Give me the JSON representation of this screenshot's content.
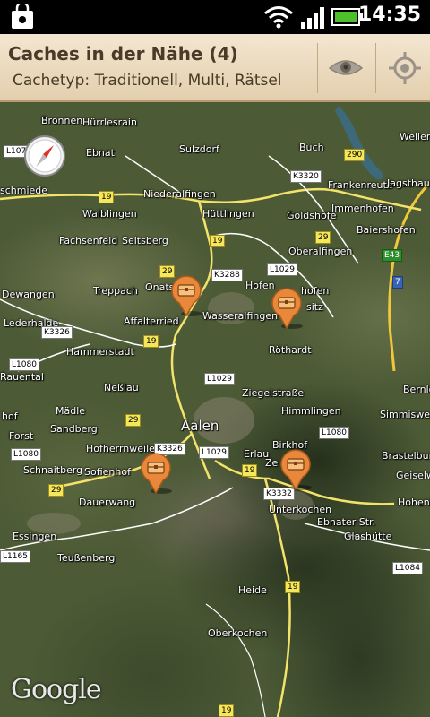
{
  "status_bar": {
    "time": "14:35",
    "icons": [
      "market-bag-icon",
      "wifi-icon",
      "signal-icon",
      "battery-icon"
    ]
  },
  "header": {
    "title": "Caches in der Nähe (4)",
    "subtitle": "Cachetyp: Traditionell, Multi, Rätsel",
    "buttons": [
      {
        "name": "visibility",
        "icon": "eye-icon"
      },
      {
        "name": "my-location",
        "icon": "crosshair-icon"
      }
    ]
  },
  "map": {
    "places": [
      {
        "id": "bronnen",
        "label": "Bronnen"
      },
      {
        "id": "hurrlesrain",
        "label": "Hürrlesrain"
      },
      {
        "id": "ebnat",
        "label": "Ebnat"
      },
      {
        "id": "sulzdorf",
        "label": "Sulzdorf"
      },
      {
        "id": "buch",
        "label": "Buch"
      },
      {
        "id": "weiler",
        "label": "Weiler"
      },
      {
        "id": "schmiede",
        "label": "schmiede"
      },
      {
        "id": "niederalfingen",
        "label": "Niederalfingen"
      },
      {
        "id": "frankenreute",
        "label": "Frankenreute"
      },
      {
        "id": "jagsthausen",
        "label": "Jagsthause"
      },
      {
        "id": "waiblingen",
        "label": "Waiblingen"
      },
      {
        "id": "huttlingen",
        "label": "Hüttlingen"
      },
      {
        "id": "goldshofe",
        "label": "Goldshöfe"
      },
      {
        "id": "immenhofen",
        "label": "Immenhofen"
      },
      {
        "id": "baiershofen",
        "label": "Baiershofen"
      },
      {
        "id": "fachsenfeld",
        "label": "Fachsenfeld"
      },
      {
        "id": "seitsberg",
        "label": "Seitsberg"
      },
      {
        "id": "oberalfingen",
        "label": "Oberalfingen"
      },
      {
        "id": "onatsfeld",
        "label": "Onatsf"
      },
      {
        "id": "hofen",
        "label": "Hofen"
      },
      {
        "id": "dewangen",
        "label": "Dewangen"
      },
      {
        "id": "treppach",
        "label": "Treppach"
      },
      {
        "id": "wasseralfingen",
        "label": "Wasseralfingen"
      },
      {
        "id": "hofen2",
        "label": "hofen"
      },
      {
        "id": "affalterried",
        "label": "Affalterried"
      },
      {
        "id": "sitz",
        "label": "sitz"
      },
      {
        "id": "hammerstadt",
        "label": "Hammerstadt"
      },
      {
        "id": "rothardt",
        "label": "Röthardt"
      },
      {
        "id": "nesslau",
        "label": "Neßlau"
      },
      {
        "id": "raudental",
        "label": "Rauental"
      },
      {
        "id": "bernlo",
        "label": "Bernlo"
      },
      {
        "id": "himmlingen",
        "label": "Himmlingen"
      },
      {
        "id": "hohenhof",
        "label": "hof"
      },
      {
        "id": "madle",
        "label": "Mädle"
      },
      {
        "id": "simmisweiler",
        "label": "Simmisweiler"
      },
      {
        "id": "aalen",
        "label": "Aalen"
      },
      {
        "id": "forst",
        "label": "Forst"
      },
      {
        "id": "sandberg",
        "label": "Sandberg"
      },
      {
        "id": "hofherrnweiler",
        "label": "Hofherrnweiler"
      },
      {
        "id": "erlau",
        "label": "Erlau"
      },
      {
        "id": "birkhof",
        "label": "Birkhof"
      },
      {
        "id": "brastelburg",
        "label": "Brastelburg"
      },
      {
        "id": "schnaitberg",
        "label": "Schnaitberg"
      },
      {
        "id": "sofienhof",
        "label": "Sofienhof"
      },
      {
        "id": "geiselwang",
        "label": "Geiselwa"
      },
      {
        "id": "dauerwang",
        "label": "Dauerwang"
      },
      {
        "id": "unterkochen",
        "label": "Unterkochen"
      },
      {
        "id": "ebnaterstr",
        "label": "Ebnater Str."
      },
      {
        "id": "hohenberg",
        "label": "Hohenbe"
      },
      {
        "id": "essingen",
        "label": "Essingen"
      },
      {
        "id": "glashutte",
        "label": "Glashütte"
      },
      {
        "id": "teussenberg",
        "label": "Teußenberg"
      },
      {
        "id": "heide",
        "label": "Heide"
      },
      {
        "id": "oberkochen",
        "label": "Oberkochen"
      },
      {
        "id": "ziegelstrasse",
        "label": "Ziegelstraße"
      },
      {
        "id": "lederhalde",
        "label": "Lederhalde"
      },
      {
        "id": "ze",
        "label": "Ze"
      }
    ],
    "road_labels": [
      {
        "id": "l1075",
        "label": "L107",
        "style": "white"
      },
      {
        "id": "b19a",
        "label": "19",
        "style": "yellow"
      },
      {
        "id": "k3320",
        "label": "K3320",
        "style": "white"
      },
      {
        "id": "r290",
        "label": "290",
        "style": "yellow"
      },
      {
        "id": "b19b",
        "label": "19",
        "style": "yellow"
      },
      {
        "id": "b29a",
        "label": "29",
        "style": "yellow"
      },
      {
        "id": "e43",
        "label": "E43",
        "style": "green"
      },
      {
        "id": "a7",
        "label": "7",
        "style": "blue"
      },
      {
        "id": "b29b",
        "label": "29",
        "style": "yellow"
      },
      {
        "id": "k3288",
        "label": "K3288",
        "style": "white"
      },
      {
        "id": "l1029a",
        "label": "L1029",
        "style": "white"
      },
      {
        "id": "k3326a",
        "label": "K3326",
        "style": "white"
      },
      {
        "id": "b19c",
        "label": "19",
        "style": "yellow"
      },
      {
        "id": "l1080a",
        "label": "L1080",
        "style": "white"
      },
      {
        "id": "l1029b",
        "label": "L1029",
        "style": "white"
      },
      {
        "id": "b29c",
        "label": "29",
        "style": "yellow"
      },
      {
        "id": "k3326b",
        "label": "K3326",
        "style": "white"
      },
      {
        "id": "l1029c",
        "label": "L1029",
        "style": "white"
      },
      {
        "id": "l1080b",
        "label": "L1080",
        "style": "white"
      },
      {
        "id": "l1080c",
        "label": "L1080",
        "style": "white"
      },
      {
        "id": "b19d",
        "label": "19",
        "style": "yellow"
      },
      {
        "id": "b29d",
        "label": "29",
        "style": "yellow"
      },
      {
        "id": "k3332",
        "label": "K3332",
        "style": "white"
      },
      {
        "id": "l1165",
        "label": "L1165",
        "style": "white"
      },
      {
        "id": "l1084",
        "label": "L1084",
        "style": "white"
      },
      {
        "id": "b19e",
        "label": "19",
        "style": "yellow"
      },
      {
        "id": "b19f",
        "label": "19",
        "style": "yellow"
      }
    ],
    "cache_markers": [
      {
        "id": "cache-1",
        "icon": "treasure-chest-icon"
      },
      {
        "id": "cache-2",
        "icon": "treasure-chest-icon"
      },
      {
        "id": "cache-3",
        "icon": "treasure-chest-icon"
      },
      {
        "id": "cache-4",
        "icon": "treasure-chest-icon"
      }
    ],
    "compass_icon": "compass-icon",
    "attribution": "Google",
    "colors": {
      "marker_orange": "#e9873a",
      "header_bg": "#ead8bb",
      "header_text": "#4a3a28"
    }
  }
}
